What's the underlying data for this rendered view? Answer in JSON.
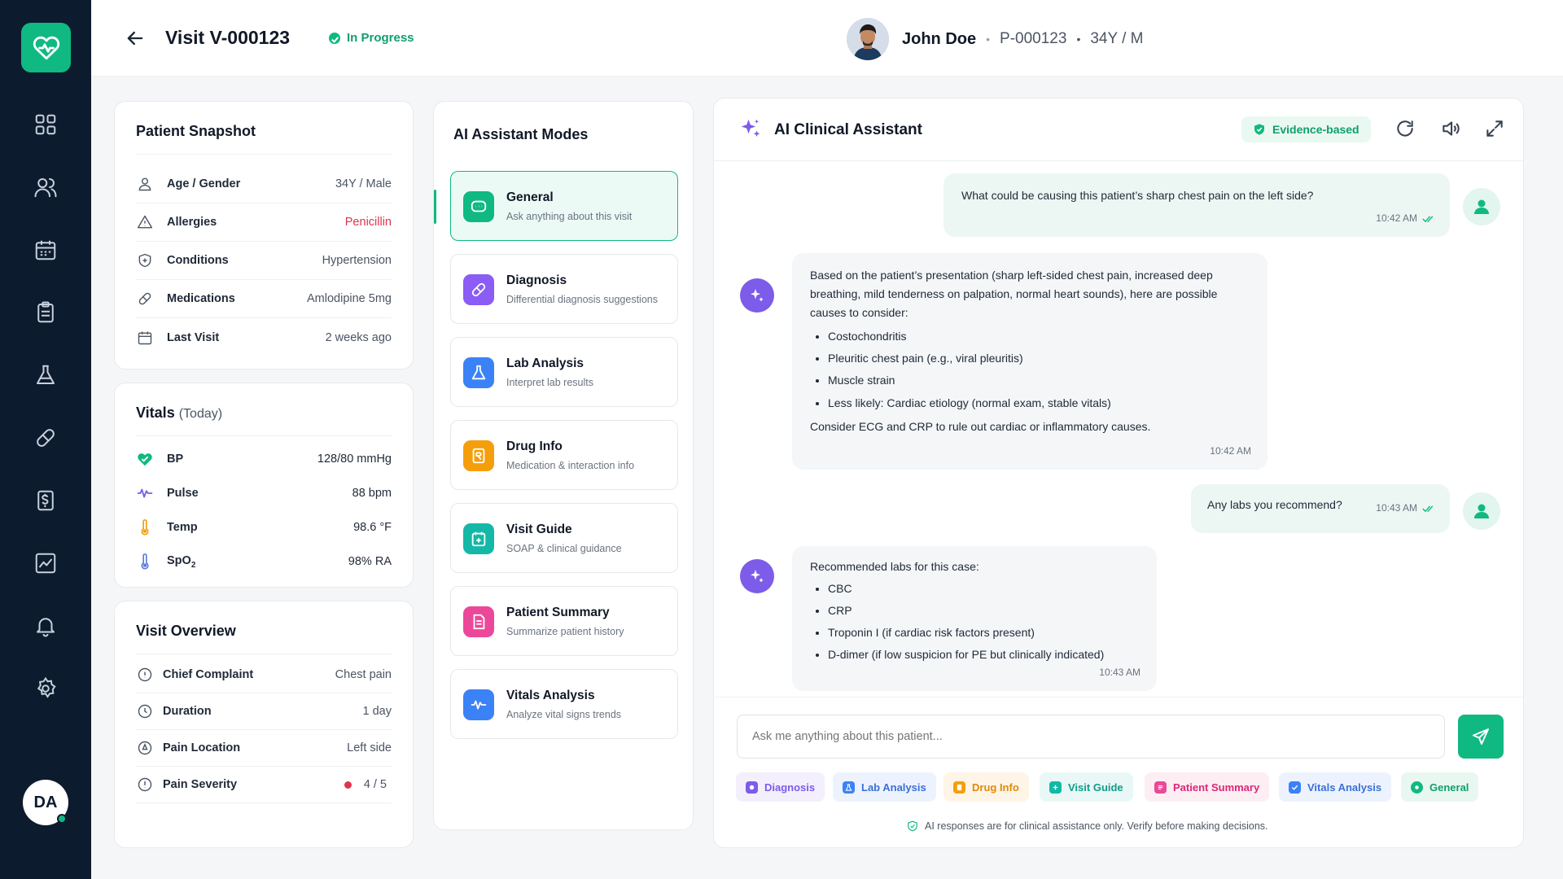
{
  "header": {
    "visit_title": "Visit V-000123",
    "status": "In Progress",
    "patient_name": "John Doe",
    "patient_id": "P-000123",
    "patient_age_sex": "34Y / M"
  },
  "sidebar": {
    "items": [
      "dashboard-icon",
      "patients-icon",
      "calendar-icon",
      "clipboard-icon",
      "lab-flask-icon",
      "pill-icon",
      "billing-icon",
      "analytics-icon",
      "bell-icon",
      "settings-icon"
    ],
    "user_initials": "DA"
  },
  "snapshot": {
    "title": "Patient Snapshot",
    "rows": [
      {
        "label": "Age / Gender",
        "value": "34Y / Male"
      },
      {
        "label": "Allergies",
        "value": "Penicillin"
      },
      {
        "label": "Conditions",
        "value": "Hypertension"
      },
      {
        "label": "Medications",
        "value": "Amlodipine 5mg"
      },
      {
        "label": "Last Visit",
        "value": "2 weeks ago"
      }
    ]
  },
  "vitals": {
    "title": "Vitals",
    "subtitle": "(Today)",
    "rows": [
      {
        "label": "BP",
        "value": "128/80 mmHg"
      },
      {
        "label": "Pulse",
        "value": "88 bpm"
      },
      {
        "label": "Temp",
        "value": "98.6 °F"
      },
      {
        "label": "SpO",
        "sub": "2",
        "value": "98% RA"
      }
    ]
  },
  "overview": {
    "title": "Visit Overview",
    "rows": [
      {
        "label": "Chief Complaint",
        "value": "Chest pain"
      },
      {
        "label": "Duration",
        "value": "1 day"
      },
      {
        "label": "Pain Location",
        "value": "Left side"
      },
      {
        "label": "Pain Severity",
        "value": "4 / 5"
      }
    ]
  },
  "modes": {
    "title": "AI Assistant Modes",
    "items": [
      {
        "title": "General",
        "subtitle": "Ask anything about this visit"
      },
      {
        "title": "Diagnosis",
        "subtitle": "Differential diagnosis suggestions"
      },
      {
        "title": "Lab Analysis",
        "subtitle": "Interpret lab results"
      },
      {
        "title": "Drug Info",
        "subtitle": "Medication & interaction info"
      },
      {
        "title": "Visit Guide",
        "subtitle": "SOAP & clinical guidance"
      },
      {
        "title": "Patient Summary",
        "subtitle": "Summarize patient history"
      },
      {
        "title": "Vitals Analysis",
        "subtitle": "Analyze vital signs trends"
      }
    ]
  },
  "assistant": {
    "title": "AI Clinical Assistant",
    "badge": "Evidence-based",
    "messages": [
      {
        "text": "What could be causing this patient’s sharp chest pain on the left side?",
        "time": "10:42 AM"
      },
      {
        "intro": "Based on the patient’s presentation (sharp left-sided chest pain, increased deep breathing, mild tenderness on palpation, normal heart sounds), here are possible causes to consider:",
        "bullets": [
          "Costochondritis",
          "Pleuritic chest pain (e.g., viral pleuritis)",
          "Muscle strain",
          "Less likely: Cardiac etiology (normal exam, stable vitals)"
        ],
        "outro": "Consider ECG and CRP to rule out cardiac or inflammatory causes.",
        "time": "10:42 AM"
      },
      {
        "text": "Any labs you recommend?",
        "time": "10:43 AM"
      },
      {
        "intro": "Recommended labs for this case:",
        "bullets": [
          "CBC",
          "CRP",
          "Troponin I (if cardiac risk factors present)",
          "D-dimer (if low suspicion for PE but clinically indicated)"
        ],
        "time": "10:43 AM"
      }
    ],
    "input_placeholder": "Ask me anything about this patient...",
    "chips": [
      "Diagnosis",
      "Lab Analysis",
      "Drug Info",
      "Visit Guide",
      "Patient Summary",
      "Vitals Analysis",
      "General"
    ],
    "disclaimer": "AI responses are for clinical assistance only. Verify before making decisions."
  },
  "colors": {
    "brand": "#10b981",
    "sidebar": "#0d1b2e",
    "ai": "#7c5ce8",
    "allergy": "#e0344d"
  }
}
